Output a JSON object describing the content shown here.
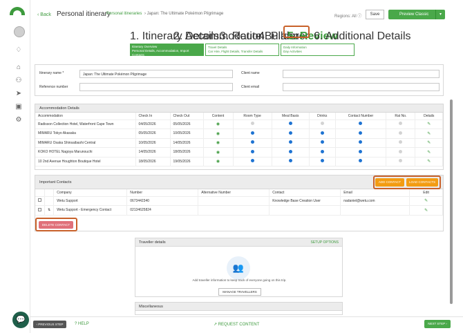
{
  "header": {
    "back_label": "Back",
    "title": "Personal itinerary",
    "breadcrumb_link": "Personal itineraries",
    "breadcrumb_current": "› Japan: The Ultimate Pokémon Pilgrimage",
    "regions_label": "Regions: All ⓘ",
    "save_label": "Save",
    "preview_label": "Preview Classic"
  },
  "steps": [
    {
      "label": "1. Itinerary Details"
    },
    {
      "label": "2. Accommodation"
    },
    {
      "label": "3. Route Builder"
    },
    {
      "label": "4. Planner"
    },
    {
      "label": "5. Review"
    },
    {
      "label": "6. Additional Details"
    }
  ],
  "substeps": [
    {
      "title": "Itinerary Overview",
      "desc": "Personal Details, Accommodation, Import Contacts"
    },
    {
      "title": "Travel Details",
      "desc": "Car Hire, Flight Details, Transfer Details"
    },
    {
      "title": "Daily Information",
      "desc": "Day Activities"
    }
  ],
  "form": {
    "itinerary_name_label": "Itinerary name *",
    "itinerary_name_value": "Japan: The Ultimate Pokémon Pilgrimage",
    "client_name_label": "Client name",
    "reference_label": "Reference number",
    "client_email_label": "Client email"
  },
  "accommodation": {
    "title": "Accommodation Details",
    "columns": [
      "Accommodation",
      "Check In",
      "Check Out",
      "Content",
      "Room Type",
      "Meal Basis",
      "Drinks",
      "Contact Number",
      "Rat No.",
      "Details"
    ],
    "rows": [
      {
        "name": "Radisson Collection Hotel, Waterfront Cape Town",
        "check_in": "04/05/2026",
        "check_out": "05/05/2026"
      },
      {
        "name": "MIMARU Tokyo Akasaka",
        "check_in": "05/05/2026",
        "check_out": "10/05/2026"
      },
      {
        "name": "MIMARU Osaka Shinsaibashi Central",
        "check_in": "10/05/2026",
        "check_out": "14/05/2026"
      },
      {
        "name": "KOKO HOTEL Nagoya Marunouchi",
        "check_in": "14/05/2026",
        "check_out": "18/05/2026"
      },
      {
        "name": "10 2nd Avenue Houghton Boutique Hotel",
        "check_in": "18/05/2026",
        "check_out": "19/05/2026"
      }
    ]
  },
  "contacts": {
    "title": "Important Contacts",
    "add_label": "ADD CONTACT",
    "load_label": "LOAD CONTACTS",
    "columns": [
      "Company",
      "Number",
      "Alternative Number",
      "Contact",
      "Email",
      "Edit"
    ],
    "rows": [
      {
        "company": "Wetu Support",
        "number": "0673442340",
        "alt": "",
        "contact": "Knowledge Base Creation User",
        "email": "nadaniel@wetu.com"
      },
      {
        "company": "Wetu Support - Emergency Contact",
        "number": "02134625824",
        "alt": "",
        "contact": "",
        "email": ""
      }
    ],
    "delete_label": "DELETE CONTACT"
  },
  "traveller": {
    "title": "Traveller details",
    "setup_label": "SETUP OPTIONS",
    "message": "Add traveller information to keep track of everyone going on this trip.",
    "manage_label": "MANAGE TRAVELLERS"
  },
  "misc": {
    "title": "Miscellaneous"
  },
  "footer": {
    "prev_label": "‹ PREVIOUS STEP",
    "help_label": "HELP",
    "request_label": "↗ REQUEST CONTENT",
    "next_label": "NEXT STEP ›"
  },
  "colors": {
    "brand_green": "#4aa84a",
    "accent_orange": "#f39c12",
    "highlight_frame": "#c8612a",
    "delete_red": "#e0707a",
    "dot_blue": "#1e73d2"
  }
}
